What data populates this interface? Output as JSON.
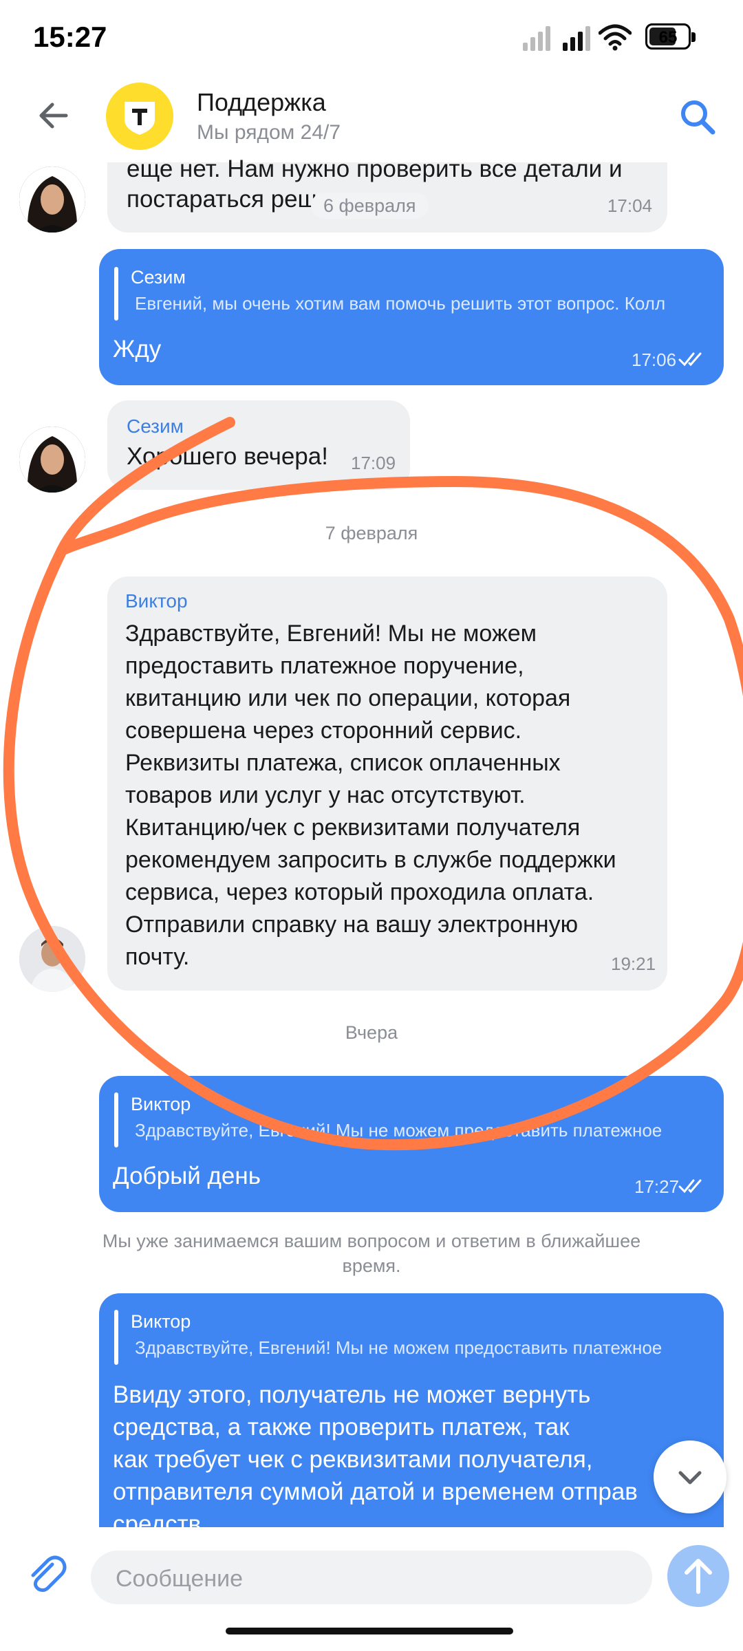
{
  "status_bar": {
    "time": "15:27",
    "battery": "65"
  },
  "header": {
    "title": "Поддержка",
    "subtitle": "Мы рядом 24/7"
  },
  "messages": {
    "m1": {
      "text_line1": "еще нет. Нам нужно проверить все детали и",
      "text_line2": "постараться решить",
      "time": "17:04"
    },
    "date1": "6 февраля",
    "m2": {
      "quote_name": "Сезим",
      "quote_text": "Евгений, мы очень хотим вам помочь решить этот вопрос. Колл",
      "text": "Жду",
      "time": "17:06"
    },
    "m3": {
      "sender": "Сезим",
      "text": "Хорошего вечера!",
      "time": "17:09"
    },
    "date2": "7 февраля",
    "m4": {
      "sender": "Виктор",
      "lines": [
        "Здравствуйте, Евгений! Мы не можем",
        "предоставить платежное поручение,",
        "квитанцию или чек по операции, которая",
        "совершена через сторонний сервис.",
        "Реквизиты платежа, список оплаченных",
        "товаров или услуг у нас отсутствуют.",
        "Квитанцию/чек с реквизитами получателя",
        "рекомендуем запросить в службе поддержки",
        "сервиса, через который проходила оплата.",
        "Отправили справку на вашу электронную",
        "почту."
      ],
      "time": "19:21"
    },
    "date3": "Вчера",
    "m5": {
      "quote_name": "Виктор",
      "quote_text": "Здравствуйте, Евгений! Мы не можем предоставить платежное",
      "text": "Добрый день",
      "time": "17:27"
    },
    "system": {
      "line1": "Мы уже занимаемся вашим вопросом и ответим в ближайшее",
      "line2": "время."
    },
    "m6": {
      "quote_name": "Виктор",
      "quote_text": "Здравствуйте, Евгений! Мы не можем предоставить платежное",
      "lines": [
        "Ввиду этого, получатель не может вернуть",
        "средства, а также проверить платеж, так",
        "как требует чек с реквизитами получателя,",
        "отправителя суммой датой и временем отправ",
        "средств"
      ]
    }
  },
  "composer": {
    "placeholder": "Сообщение"
  },
  "icons": {
    "back": "arrow-left-icon",
    "logo": "bank-logo-icon",
    "search": "search-icon",
    "attach": "paperclip-icon",
    "send": "arrow-up-icon",
    "scroll": "chevron-down-icon",
    "read": "double-check-icon"
  },
  "colors": {
    "accent": "#3f86f3",
    "brand_yellow": "#ffdd2d",
    "annotation": "#ff7a45",
    "incoming_bg": "#eff0f2"
  }
}
